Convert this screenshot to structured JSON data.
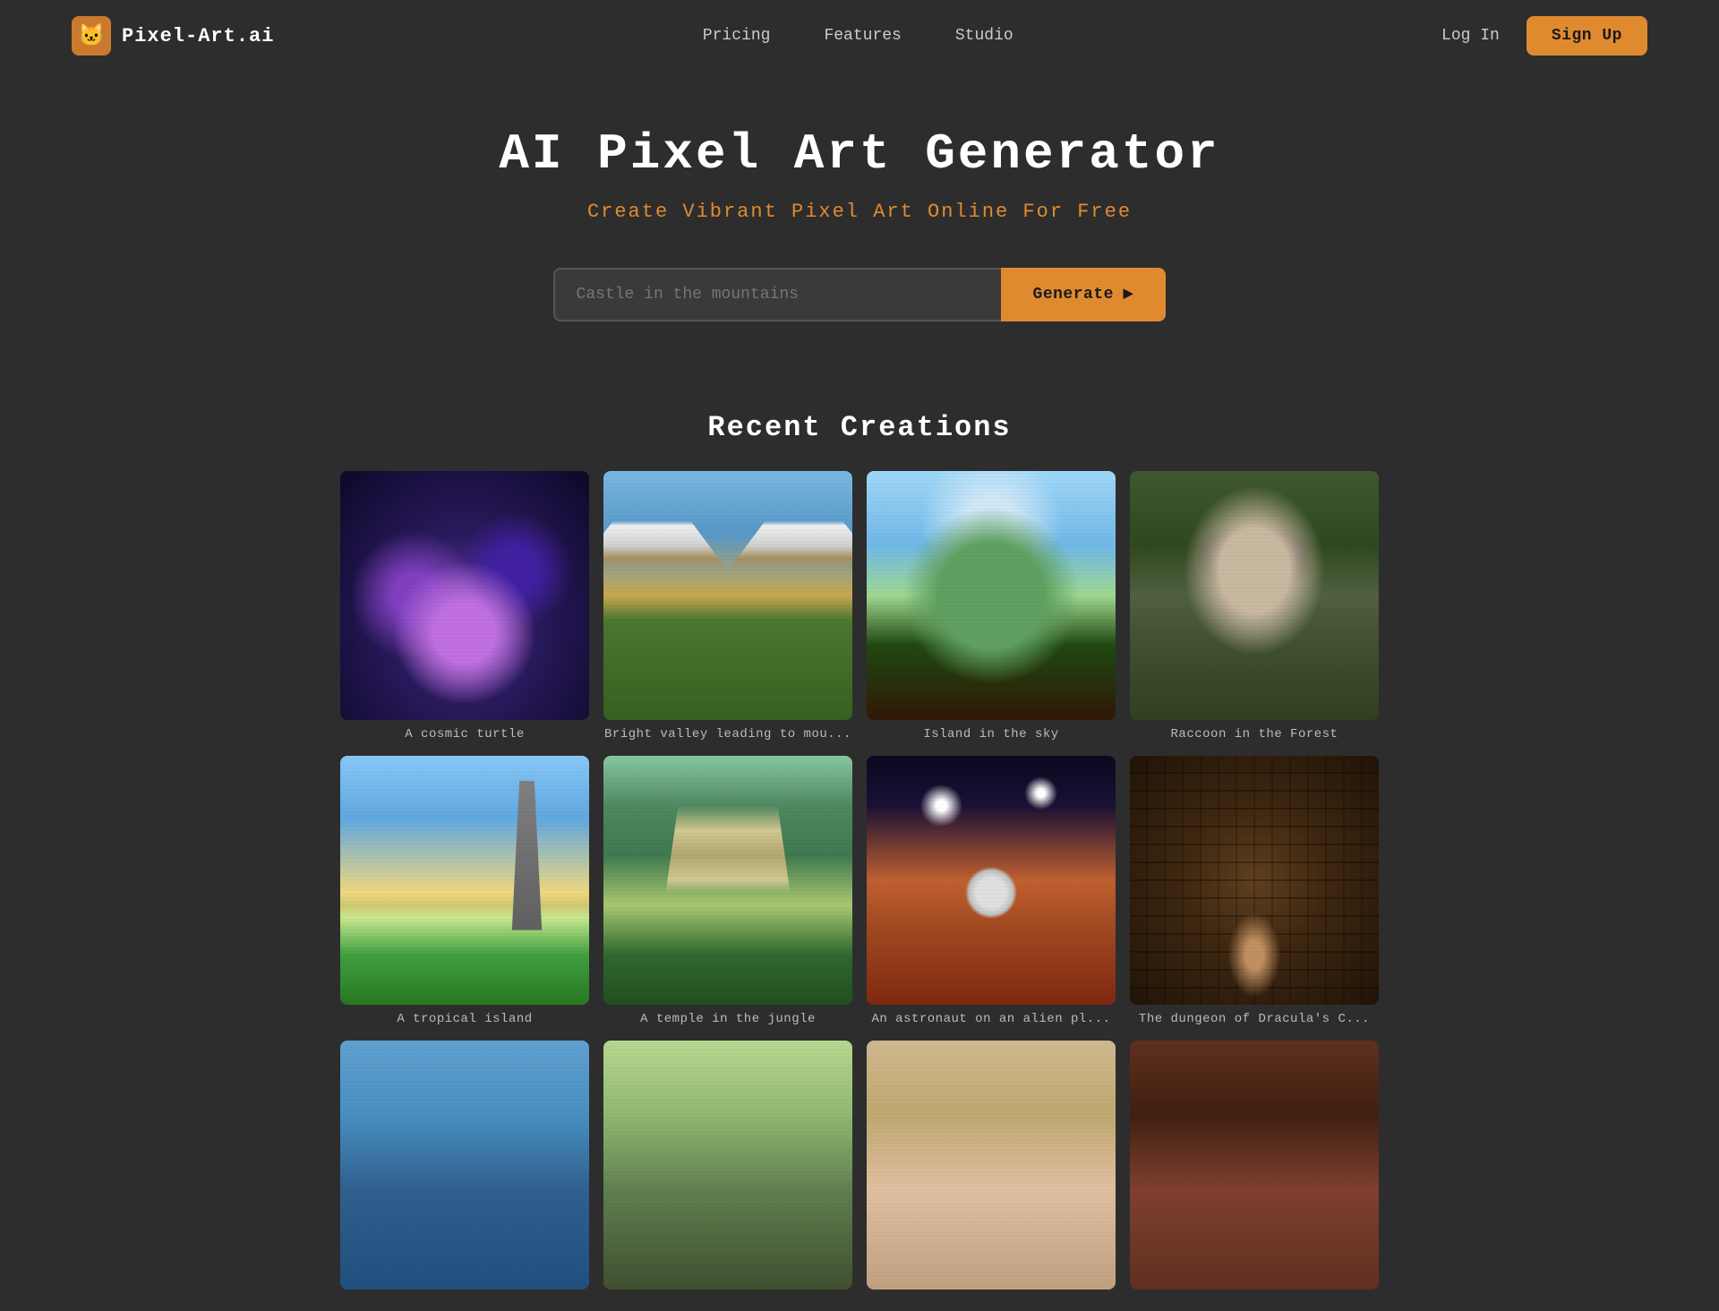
{
  "nav": {
    "logo_text": "Pixel-Art.ai",
    "logo_icon": "🐱",
    "links": [
      {
        "label": "Pricing",
        "href": "#"
      },
      {
        "label": "Features",
        "href": "#"
      },
      {
        "label": "Studio",
        "href": "#"
      }
    ],
    "login_label": "Log In",
    "signup_label": "Sign Up"
  },
  "hero": {
    "title": "AI Pixel Art Generator",
    "subtitle": "Create Vibrant Pixel Art Online For Free"
  },
  "search": {
    "placeholder": "Castle in the mountains",
    "button_label": "Generate"
  },
  "recent": {
    "title": "Recent Creations",
    "row1": [
      {
        "label": "A cosmic turtle",
        "img_class": "img-cosmic-turtle"
      },
      {
        "label": "Bright valley leading to mou...",
        "img_class": "img-valley"
      },
      {
        "label": "Island in the sky",
        "img_class": "img-island"
      },
      {
        "label": "Raccoon in the Forest",
        "img_class": "img-raccoon"
      }
    ],
    "row2": [
      {
        "label": "A tropical island",
        "img_class": "img-tropical"
      },
      {
        "label": "A temple in the jungle",
        "img_class": "img-temple"
      },
      {
        "label": "An astronaut on an alien pl...",
        "img_class": "img-astronaut"
      },
      {
        "label": "The dungeon of Dracula's C...",
        "img_class": "img-dungeon"
      }
    ],
    "row3": [
      {
        "label": "",
        "img_class": "img-partial1"
      },
      {
        "label": "",
        "img_class": "img-partial2"
      },
      {
        "label": "",
        "img_class": "img-partial3"
      },
      {
        "label": "",
        "img_class": "img-partial4"
      }
    ]
  },
  "colors": {
    "accent": "#e08a30",
    "bg": "#2d2d2d",
    "text": "#ffffff",
    "muted": "#bbbbbb"
  }
}
